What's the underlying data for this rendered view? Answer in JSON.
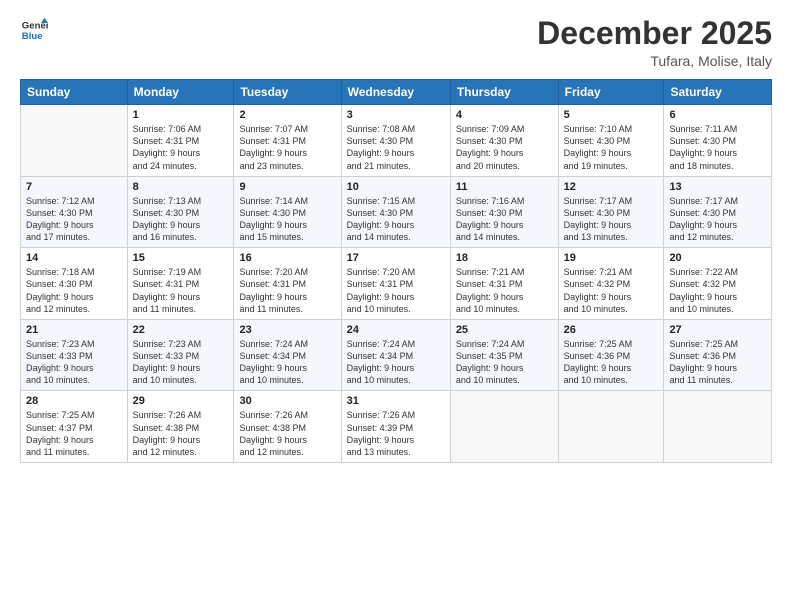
{
  "header": {
    "logo_line1": "General",
    "logo_line2": "Blue",
    "title": "December 2025",
    "subtitle": "Tufara, Molise, Italy"
  },
  "weekdays": [
    "Sunday",
    "Monday",
    "Tuesday",
    "Wednesday",
    "Thursday",
    "Friday",
    "Saturday"
  ],
  "weeks": [
    [
      {
        "day": "",
        "info": ""
      },
      {
        "day": "1",
        "info": "Sunrise: 7:06 AM\nSunset: 4:31 PM\nDaylight: 9 hours\nand 24 minutes."
      },
      {
        "day": "2",
        "info": "Sunrise: 7:07 AM\nSunset: 4:31 PM\nDaylight: 9 hours\nand 23 minutes."
      },
      {
        "day": "3",
        "info": "Sunrise: 7:08 AM\nSunset: 4:30 PM\nDaylight: 9 hours\nand 21 minutes."
      },
      {
        "day": "4",
        "info": "Sunrise: 7:09 AM\nSunset: 4:30 PM\nDaylight: 9 hours\nand 20 minutes."
      },
      {
        "day": "5",
        "info": "Sunrise: 7:10 AM\nSunset: 4:30 PM\nDaylight: 9 hours\nand 19 minutes."
      },
      {
        "day": "6",
        "info": "Sunrise: 7:11 AM\nSunset: 4:30 PM\nDaylight: 9 hours\nand 18 minutes."
      }
    ],
    [
      {
        "day": "7",
        "info": "Sunrise: 7:12 AM\nSunset: 4:30 PM\nDaylight: 9 hours\nand 17 minutes."
      },
      {
        "day": "8",
        "info": "Sunrise: 7:13 AM\nSunset: 4:30 PM\nDaylight: 9 hours\nand 16 minutes."
      },
      {
        "day": "9",
        "info": "Sunrise: 7:14 AM\nSunset: 4:30 PM\nDaylight: 9 hours\nand 15 minutes."
      },
      {
        "day": "10",
        "info": "Sunrise: 7:15 AM\nSunset: 4:30 PM\nDaylight: 9 hours\nand 14 minutes."
      },
      {
        "day": "11",
        "info": "Sunrise: 7:16 AM\nSunset: 4:30 PM\nDaylight: 9 hours\nand 14 minutes."
      },
      {
        "day": "12",
        "info": "Sunrise: 7:17 AM\nSunset: 4:30 PM\nDaylight: 9 hours\nand 13 minutes."
      },
      {
        "day": "13",
        "info": "Sunrise: 7:17 AM\nSunset: 4:30 PM\nDaylight: 9 hours\nand 12 minutes."
      }
    ],
    [
      {
        "day": "14",
        "info": "Sunrise: 7:18 AM\nSunset: 4:30 PM\nDaylight: 9 hours\nand 12 minutes."
      },
      {
        "day": "15",
        "info": "Sunrise: 7:19 AM\nSunset: 4:31 PM\nDaylight: 9 hours\nand 11 minutes."
      },
      {
        "day": "16",
        "info": "Sunrise: 7:20 AM\nSunset: 4:31 PM\nDaylight: 9 hours\nand 11 minutes."
      },
      {
        "day": "17",
        "info": "Sunrise: 7:20 AM\nSunset: 4:31 PM\nDaylight: 9 hours\nand 10 minutes."
      },
      {
        "day": "18",
        "info": "Sunrise: 7:21 AM\nSunset: 4:31 PM\nDaylight: 9 hours\nand 10 minutes."
      },
      {
        "day": "19",
        "info": "Sunrise: 7:21 AM\nSunset: 4:32 PM\nDaylight: 9 hours\nand 10 minutes."
      },
      {
        "day": "20",
        "info": "Sunrise: 7:22 AM\nSunset: 4:32 PM\nDaylight: 9 hours\nand 10 minutes."
      }
    ],
    [
      {
        "day": "21",
        "info": "Sunrise: 7:23 AM\nSunset: 4:33 PM\nDaylight: 9 hours\nand 10 minutes."
      },
      {
        "day": "22",
        "info": "Sunrise: 7:23 AM\nSunset: 4:33 PM\nDaylight: 9 hours\nand 10 minutes."
      },
      {
        "day": "23",
        "info": "Sunrise: 7:24 AM\nSunset: 4:34 PM\nDaylight: 9 hours\nand 10 minutes."
      },
      {
        "day": "24",
        "info": "Sunrise: 7:24 AM\nSunset: 4:34 PM\nDaylight: 9 hours\nand 10 minutes."
      },
      {
        "day": "25",
        "info": "Sunrise: 7:24 AM\nSunset: 4:35 PM\nDaylight: 9 hours\nand 10 minutes."
      },
      {
        "day": "26",
        "info": "Sunrise: 7:25 AM\nSunset: 4:36 PM\nDaylight: 9 hours\nand 10 minutes."
      },
      {
        "day": "27",
        "info": "Sunrise: 7:25 AM\nSunset: 4:36 PM\nDaylight: 9 hours\nand 11 minutes."
      }
    ],
    [
      {
        "day": "28",
        "info": "Sunrise: 7:25 AM\nSunset: 4:37 PM\nDaylight: 9 hours\nand 11 minutes."
      },
      {
        "day": "29",
        "info": "Sunrise: 7:26 AM\nSunset: 4:38 PM\nDaylight: 9 hours\nand 12 minutes."
      },
      {
        "day": "30",
        "info": "Sunrise: 7:26 AM\nSunset: 4:38 PM\nDaylight: 9 hours\nand 12 minutes."
      },
      {
        "day": "31",
        "info": "Sunrise: 7:26 AM\nSunset: 4:39 PM\nDaylight: 9 hours\nand 13 minutes."
      },
      {
        "day": "",
        "info": ""
      },
      {
        "day": "",
        "info": ""
      },
      {
        "day": "",
        "info": ""
      }
    ]
  ]
}
